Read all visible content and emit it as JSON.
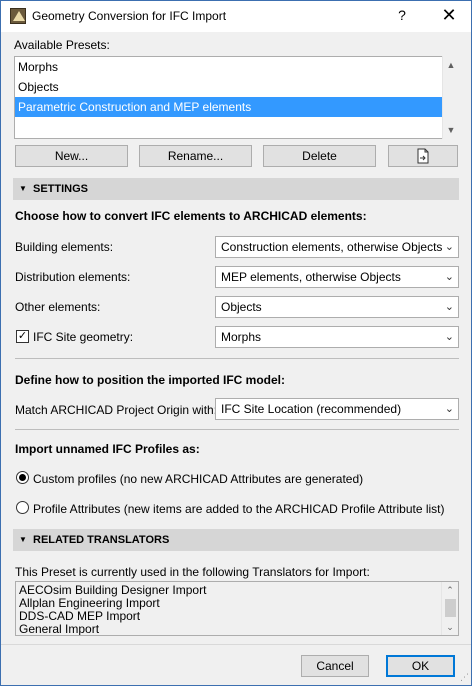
{
  "window": {
    "title": "Geometry Conversion for IFC Import",
    "help_label": "?",
    "close_label": "✕"
  },
  "presets": {
    "label": "Available Presets:",
    "items": [
      {
        "label": "Morphs",
        "selected": false
      },
      {
        "label": "Objects",
        "selected": false
      },
      {
        "label": "Parametric Construction and MEP elements",
        "selected": true
      }
    ],
    "buttons": {
      "new": "New...",
      "rename": "Rename...",
      "delete": "Delete",
      "export_icon": "export-document-icon"
    }
  },
  "settings": {
    "header": "SETTINGS",
    "convert_heading": "Choose how to convert IFC elements to ARCHICAD elements:",
    "building_label": "Building elements:",
    "building_value": "Construction elements, otherwise Objects",
    "distribution_label": "Distribution elements:",
    "distribution_value": "MEP elements, otherwise Objects",
    "other_label": "Other elements:",
    "other_value": "Objects",
    "site_label": "IFC Site geometry:",
    "site_checked": true,
    "site_value": "Morphs",
    "position_heading": "Define how to position the imported IFC model:",
    "match_label": "Match ARCHICAD Project Origin with:",
    "match_value": "IFC Site Location (recommended)",
    "profiles_heading": "Import unnamed IFC Profiles as:",
    "radio_custom": "Custom profiles (no new ARCHICAD Attributes are generated)",
    "radio_profile_attr": "Profile Attributes (new items are added to the ARCHICAD Profile Attribute list)",
    "selected_radio": "custom"
  },
  "related": {
    "header": "RELATED TRANSLATORS",
    "description": "This Preset is currently used in the following Translators for Import:",
    "items": [
      "AECOsim Building Designer Import",
      "Allplan Engineering Import",
      "DDS-CAD MEP Import",
      "General Import"
    ]
  },
  "footer": {
    "cancel": "Cancel",
    "ok": "OK"
  }
}
